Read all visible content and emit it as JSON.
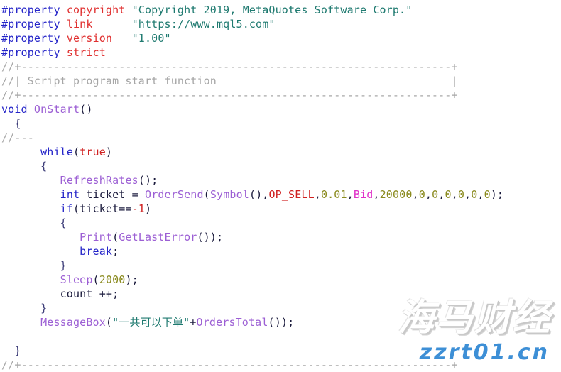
{
  "editor": {
    "language": "MQL4",
    "background_color": "#ffffff",
    "font_size_px": 15,
    "line_height_px": 20,
    "colors": {
      "preprocessor": "#2424c8",
      "property_name": "#e03030",
      "string": "#1f7a70",
      "comment": "#a6a6a6",
      "keyword": "#2424c8",
      "function": "#9c5fd4",
      "constant": "#d02020",
      "number": "#8a8a1e",
      "enum": "#d02020",
      "variable": "#e030c8",
      "plain": "#1a1a3c"
    },
    "lines": [
      {
        "n": 1,
        "tokens": [
          {
            "t": "#property ",
            "c": "pre"
          },
          {
            "t": "copyright ",
            "c": "prop"
          },
          {
            "t": "\"Copyright 2019, MetaQuotes Software Corp.\"",
            "c": "str"
          }
        ]
      },
      {
        "n": 2,
        "tokens": [
          {
            "t": "#property ",
            "c": "pre"
          },
          {
            "t": "link      ",
            "c": "prop"
          },
          {
            "t": "\"https://www.mql5.com\"",
            "c": "str"
          }
        ]
      },
      {
        "n": 3,
        "tokens": [
          {
            "t": "#property ",
            "c": "pre"
          },
          {
            "t": "version   ",
            "c": "prop"
          },
          {
            "t": "\"1.00\"",
            "c": "str"
          }
        ]
      },
      {
        "n": 4,
        "tokens": [
          {
            "t": "#property ",
            "c": "pre"
          },
          {
            "t": "strict",
            "c": "prop"
          }
        ]
      },
      {
        "n": 5,
        "tokens": [
          {
            "t": "//+------------------------------------------------------------------+",
            "c": "comment"
          }
        ]
      },
      {
        "n": 6,
        "tokens": [
          {
            "t": "//| Script program start function                                    |",
            "c": "comment"
          }
        ]
      },
      {
        "n": 7,
        "tokens": [
          {
            "t": "//+------------------------------------------------------------------+",
            "c": "comment"
          }
        ]
      },
      {
        "n": 8,
        "tokens": [
          {
            "t": "void ",
            "c": "kw"
          },
          {
            "t": "OnStart",
            "c": "fn"
          },
          {
            "t": "()",
            "c": "plain"
          }
        ]
      },
      {
        "n": 9,
        "tokens": [
          {
            "t": "  {",
            "c": "brace"
          }
        ]
      },
      {
        "n": 10,
        "tokens": [
          {
            "t": "//---",
            "c": "comment"
          }
        ]
      },
      {
        "n": 11,
        "tokens": [
          {
            "t": "      ",
            "c": "plain"
          },
          {
            "t": "while",
            "c": "kw"
          },
          {
            "t": "(",
            "c": "plain"
          },
          {
            "t": "true",
            "c": "const"
          },
          {
            "t": ")",
            "c": "plain"
          }
        ]
      },
      {
        "n": 12,
        "tokens": [
          {
            "t": "      {",
            "c": "brace"
          }
        ]
      },
      {
        "n": 13,
        "tokens": [
          {
            "t": "         ",
            "c": "plain"
          },
          {
            "t": "RefreshRates",
            "c": "fn"
          },
          {
            "t": "();",
            "c": "plain"
          }
        ]
      },
      {
        "n": 14,
        "tokens": [
          {
            "t": "         ",
            "c": "plain"
          },
          {
            "t": "int ",
            "c": "kw"
          },
          {
            "t": "ticket = ",
            "c": "plain"
          },
          {
            "t": "OrderSend",
            "c": "fn"
          },
          {
            "t": "(",
            "c": "plain"
          },
          {
            "t": "Symbol",
            "c": "fn"
          },
          {
            "t": "(),",
            "c": "plain"
          },
          {
            "t": "OP_SELL",
            "c": "enum"
          },
          {
            "t": ",",
            "c": "plain"
          },
          {
            "t": "0.01",
            "c": "num"
          },
          {
            "t": ",",
            "c": "plain"
          },
          {
            "t": "Bid",
            "c": "var"
          },
          {
            "t": ",",
            "c": "plain"
          },
          {
            "t": "20000",
            "c": "num"
          },
          {
            "t": ",",
            "c": "plain"
          },
          {
            "t": "0",
            "c": "num"
          },
          {
            "t": ",",
            "c": "plain"
          },
          {
            "t": "0",
            "c": "num"
          },
          {
            "t": ",",
            "c": "plain"
          },
          {
            "t": "0",
            "c": "num"
          },
          {
            "t": ",",
            "c": "plain"
          },
          {
            "t": "0",
            "c": "num"
          },
          {
            "t": ",",
            "c": "plain"
          },
          {
            "t": "0",
            "c": "num"
          },
          {
            "t": ",",
            "c": "plain"
          },
          {
            "t": "0",
            "c": "num"
          },
          {
            "t": ");",
            "c": "plain"
          }
        ]
      },
      {
        "n": 15,
        "tokens": [
          {
            "t": "         ",
            "c": "plain"
          },
          {
            "t": "if",
            "c": "kw"
          },
          {
            "t": "(ticket==",
            "c": "plain"
          },
          {
            "t": "-1",
            "c": "const"
          },
          {
            "t": ")",
            "c": "plain"
          }
        ]
      },
      {
        "n": 16,
        "tokens": [
          {
            "t": "         {",
            "c": "brace"
          }
        ]
      },
      {
        "n": 17,
        "tokens": [
          {
            "t": "            ",
            "c": "plain"
          },
          {
            "t": "Print",
            "c": "fn"
          },
          {
            "t": "(",
            "c": "plain"
          },
          {
            "t": "GetLastError",
            "c": "fn"
          },
          {
            "t": "());",
            "c": "plain"
          }
        ]
      },
      {
        "n": 18,
        "tokens": [
          {
            "t": "            ",
            "c": "plain"
          },
          {
            "t": "break",
            "c": "kw"
          },
          {
            "t": ";",
            "c": "plain"
          }
        ]
      },
      {
        "n": 19,
        "tokens": [
          {
            "t": "         }",
            "c": "brace"
          }
        ]
      },
      {
        "n": 20,
        "tokens": [
          {
            "t": "         ",
            "c": "plain"
          },
          {
            "t": "Sleep",
            "c": "fn"
          },
          {
            "t": "(",
            "c": "plain"
          },
          {
            "t": "2000",
            "c": "num"
          },
          {
            "t": ");",
            "c": "plain"
          }
        ]
      },
      {
        "n": 21,
        "tokens": [
          {
            "t": "         count ++;",
            "c": "plain"
          }
        ]
      },
      {
        "n": 22,
        "tokens": [
          {
            "t": "      }",
            "c": "brace"
          }
        ]
      },
      {
        "n": 23,
        "tokens": [
          {
            "t": "      ",
            "c": "plain"
          },
          {
            "t": "MessageBox",
            "c": "fn"
          },
          {
            "t": "(",
            "c": "plain"
          },
          {
            "t": "\"一共可以下单\"",
            "c": "str"
          },
          {
            "t": "+",
            "c": "plain"
          },
          {
            "t": "OrdersTotal",
            "c": "fn"
          },
          {
            "t": "());",
            "c": "plain"
          }
        ]
      },
      {
        "n": 24,
        "tokens": [
          {
            "t": "",
            "c": "plain"
          }
        ]
      },
      {
        "n": 25,
        "tokens": [
          {
            "t": "  }",
            "c": "brace"
          }
        ]
      },
      {
        "n": 26,
        "tokens": [
          {
            "t": "//+------------------------------------------------------------------+",
            "c": "comment"
          }
        ]
      }
    ]
  },
  "watermark": {
    "chinese_text": "海马财经",
    "site_text": "zzrt01.cn",
    "site_color": "#3d8fd6",
    "chinese_color": "#ffffff"
  }
}
